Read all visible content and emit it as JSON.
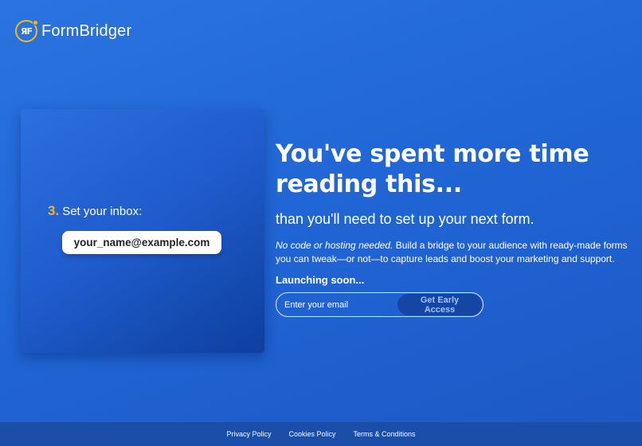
{
  "brand": {
    "logo_letters": "ЯF",
    "name": "FormBridger",
    "accent_color": "#f2b817"
  },
  "card": {
    "step_number": "3.",
    "step_label": "Set your inbox:",
    "inbox_example": "your_name@example.com"
  },
  "hero": {
    "headline_line1": "You've spent more time",
    "headline_line2": "reading this...",
    "subhead": "than you'll need to set up your next form.",
    "desc_italic": "No code or hosting needed.",
    "desc_rest": " Build a bridge to your audience with ready-made forms you can tweak—or not—to capture leads and boost your marketing and support.",
    "launch_label": "Launching soon..."
  },
  "signup": {
    "email_placeholder": "Enter your email",
    "button_label": "Get Early Access"
  },
  "footer": {
    "links": [
      "Privacy Policy",
      "Cookies Policy",
      "Terms & Conditions"
    ]
  }
}
